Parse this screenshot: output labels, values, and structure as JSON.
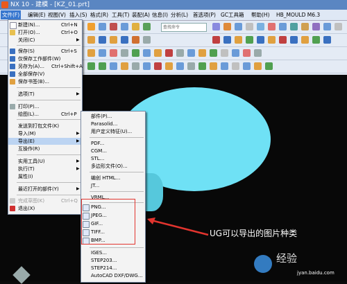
{
  "window": {
    "title": "NX 10 - 建模 - [KZ_01.prt]"
  },
  "menubar": {
    "items": [
      {
        "label": "文件(F)",
        "active": true
      },
      {
        "label": "编辑(E)"
      },
      {
        "label": "视图(V)"
      },
      {
        "label": "插入(S)"
      },
      {
        "label": "格式(R)"
      },
      {
        "label": "工具(T)"
      },
      {
        "label": "装配(A)"
      },
      {
        "label": "信息(I)"
      },
      {
        "label": "分析(L)"
      },
      {
        "label": "首选项(P)"
      },
      {
        "label": "GC工具箱"
      },
      {
        "label": "帮助(H)"
      },
      {
        "label": "HB_MOULD M6.3"
      }
    ]
  },
  "toolbar": {
    "command_finder_placeholder": "查找命令"
  },
  "file_menu": {
    "items": [
      {
        "label": "新建(N)...",
        "shortcut": "Ctrl+N",
        "icon": "new-file-icon"
      },
      {
        "label": "打开(O)...",
        "shortcut": "Ctrl+O",
        "icon": "open-folder-icon"
      },
      {
        "label": "关闭(C)",
        "submenu": true
      },
      {
        "label": "保存(S)",
        "shortcut": "Ctrl+S",
        "icon": "save-icon"
      },
      {
        "label": "仅保存工作部件(W)",
        "icon": "save-work-part-icon"
      },
      {
        "label": "另存为(A)...",
        "shortcut": "Ctrl+Shift+A",
        "icon": "save-as-icon"
      },
      {
        "label": "全部保存(V)",
        "icon": "save-all-icon"
      },
      {
        "label": "保存书签(B)...",
        "icon": "bookmark-icon"
      },
      {
        "label": "选项(T)",
        "submenu": true
      },
      {
        "label": "打印(P)...",
        "icon": "print-icon"
      },
      {
        "label": "绘图(L)...",
        "shortcut": "Ctrl+P"
      },
      {
        "label": "发送到打包文件(K)"
      },
      {
        "label": "导入(M)",
        "submenu": true
      },
      {
        "label": "导出(E)",
        "submenu": true,
        "highlighted": true
      },
      {
        "label": "互操作(R)"
      },
      {
        "label": "实用工具(U)",
        "submenu": true
      },
      {
        "label": "执行(T)",
        "submenu": true
      },
      {
        "label": "属性(I)"
      },
      {
        "label": "最近打开的部件(Y)",
        "submenu": true
      },
      {
        "label": "完成草图(K)",
        "shortcut": "Ctrl+Q",
        "disabled": true,
        "icon": "finish-sketch-icon"
      },
      {
        "label": "退出(X)",
        "icon": "exit-icon"
      }
    ]
  },
  "export_menu": {
    "items": [
      {
        "label": "部件(P)..."
      },
      {
        "label": "Parasolid..."
      },
      {
        "label": "用户定义特征(U)..."
      },
      {
        "label": "PDF..."
      },
      {
        "label": "CGM..."
      },
      {
        "label": "STL..."
      },
      {
        "label": "多边形文件(O)..."
      },
      {
        "label": "编创 HTML..."
      },
      {
        "label": "JT..."
      },
      {
        "label": "VRML..."
      },
      {
        "label": "PNG...",
        "icon": "png-icon"
      },
      {
        "label": "JPEG...",
        "icon": "jpeg-icon"
      },
      {
        "label": "GIF...",
        "icon": "gif-icon"
      },
      {
        "label": "TIFF...",
        "icon": "tiff-icon"
      },
      {
        "label": "BMP...",
        "icon": "bmp-icon"
      },
      {
        "label": "IGES..."
      },
      {
        "label": "STEP203..."
      },
      {
        "label": "STEP214..."
      },
      {
        "label": "AutoCAD DXF/DWG..."
      }
    ]
  },
  "annotation": {
    "text": "UG可以导出的图片种类",
    "color": "#e2342e"
  },
  "watermark": {
    "text": "经验",
    "site": "jyan.baidu.com"
  },
  "colors": {
    "part": "#6fe1f5",
    "title_bar": "#5a86c2",
    "menu_highlight": "#bcd4f2"
  }
}
